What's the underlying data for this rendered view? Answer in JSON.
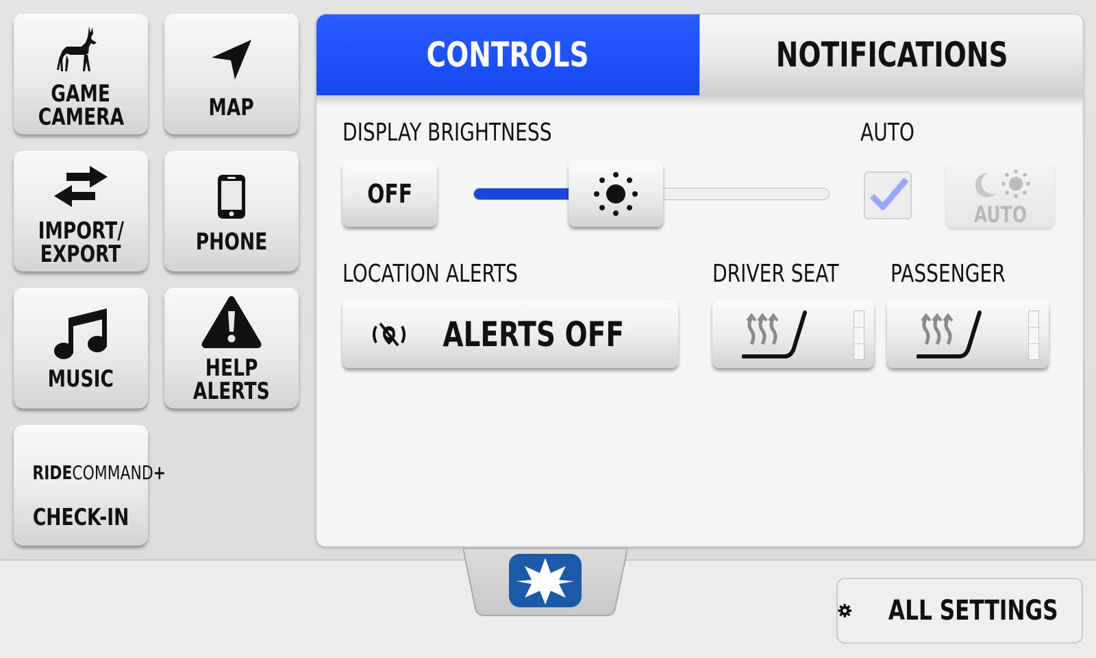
{
  "sidebar": {
    "tiles": [
      {
        "id": "game-camera",
        "line1": "GAME",
        "line2": "CAMERA",
        "icon": "deer-icon"
      },
      {
        "id": "map",
        "line1": "MAP",
        "icon": "navigation-arrow-icon"
      },
      {
        "id": "import-export",
        "line1": "IMPORT/",
        "line2": "EXPORT",
        "icon": "swap-arrows-icon"
      },
      {
        "id": "phone",
        "line1": "PHONE",
        "icon": "smartphone-icon"
      },
      {
        "id": "music",
        "line1": "MUSIC",
        "icon": "music-note-icon"
      },
      {
        "id": "help-alerts",
        "line1": "HELP",
        "line2": "ALERTS",
        "icon": "warning-triangle-icon"
      },
      {
        "id": "ride-command-checkin",
        "brand_bold": "RIDE",
        "brand_light": "COMMAND",
        "brand_plus": "+",
        "line1": "CHECK-IN"
      }
    ]
  },
  "tabs": {
    "controls": "CONTROLS",
    "notifications": "NOTIFICATIONS",
    "active": "controls"
  },
  "controls": {
    "display_brightness_label": "DISPLAY BRIGHTNESS",
    "auto_label": "AUTO",
    "off_button": "OFF",
    "brightness_level": 0.4,
    "auto_checked": true,
    "auto_button_label": "AUTO",
    "auto_button_disabled": true,
    "location_alerts_label": "LOCATION ALERTS",
    "alerts_button": "ALERTS OFF",
    "driver_seat_label": "DRIVER SEAT",
    "passenger_label": "PASSENGER"
  },
  "footer": {
    "all_settings": "ALL SETTINGS"
  },
  "colors": {
    "accent": "#1a4df5",
    "slider_fill": "#1845e0",
    "logo_blue": "#1a5aa8"
  }
}
